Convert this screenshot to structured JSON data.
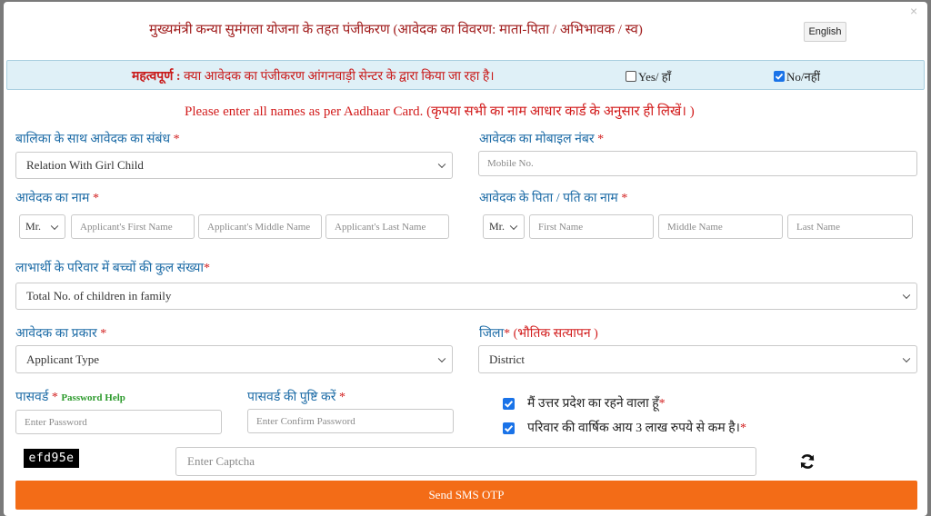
{
  "modal": {
    "close_glyph": "×",
    "title": "मुख्यमंत्री कन्या सुमंगला योजना के तहत पंजीकरण (आवेदक का विवरण: माता-पिता / अभिभावक / स्व)",
    "lang_button": "English"
  },
  "notice": {
    "prefix": "महत्वपूर्ण :",
    "question": " क्या आवेदक का पंजीकरण आंगनवाड़ी सेन्टर के द्वारा किया जा रहा है।",
    "yes_label": "Yes/ हाँ",
    "yes_checked": false,
    "no_label": "No/नहीं",
    "no_checked": true
  },
  "aadhaar_note": "Please enter all names as per Aadhaar Card. (कृपया सभी का नाम आधार कार्ड के अनुसार ही लिखें। )",
  "relation": {
    "label": "बालिका के साथ आवेदक का संबंध",
    "required": "*",
    "selected": "Relation With Girl Child"
  },
  "mobile": {
    "label": "आवेदक का मोबाइल नंबर",
    "required": "*",
    "placeholder": "Mobile No."
  },
  "applicant_name": {
    "label": "आवेदक का नाम",
    "required": "*",
    "title_selected": "Mr.",
    "first_placeholder": "Applicant's First Name",
    "middle_placeholder": "Applicant's Middle Name",
    "last_placeholder": "Applicant's Last Name"
  },
  "father_name": {
    "label": "आवेदक के पिता / पति का नाम",
    "required": "*",
    "title_selected": "Mr.",
    "first_placeholder": "First Name",
    "middle_placeholder": "Middle Name",
    "last_placeholder": "Last Name"
  },
  "children": {
    "label": "लाभार्थी के परिवार में बच्चों की कुल संख्या",
    "required": "*",
    "selected": "Total No. of children in family"
  },
  "applicant_type": {
    "label": "आवेदक का प्रकार",
    "required": "*",
    "selected": "Applicant Type"
  },
  "district": {
    "label": "जिला",
    "required": "* (भौतिक सत्यापन )",
    "selected": "District"
  },
  "password": {
    "label": "पासवर्ड",
    "required": "*",
    "help": "Password Help",
    "placeholder": "Enter Password"
  },
  "confirm_password": {
    "label": "पासवर्ड की पुष्टि करें",
    "required": "*",
    "placeholder": "Enter Confirm Password"
  },
  "declarations": [
    {
      "text": "मैं उत्तर प्रदेश का रहने वाला हूँ",
      "required": "*",
      "checked": true
    },
    {
      "text": "परिवार की वार्षिक आय 3 लाख रुपये से कम है।",
      "required": "*",
      "checked": true
    }
  ],
  "captcha": {
    "code": "efd95e",
    "placeholder": "Enter Captcha",
    "refresh_icon": "refresh-icon"
  },
  "submit_label": "Send SMS OTP",
  "colors": {
    "accent_orange": "#f36c17",
    "label_blue": "#1c6ba6",
    "required_red": "#d21c1c",
    "notice_bg": "#dff0f7"
  }
}
